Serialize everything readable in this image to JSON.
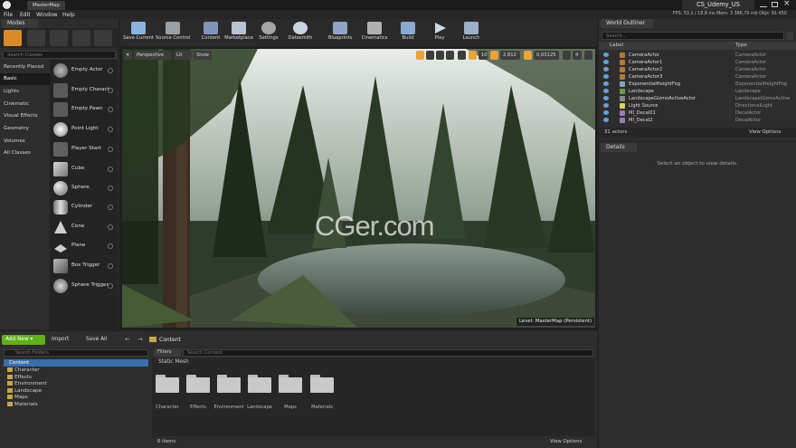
{
  "window": {
    "tab_title": "MasterMap",
    "project": "CS_Udemy_US",
    "menu": [
      "File",
      "Edit",
      "Window",
      "Help"
    ],
    "stats": "FPS: 53.2 / 18.8 ms   Mem: 3 386,79 mb   Objs: 91 450"
  },
  "modes": {
    "tab_label": "Modes",
    "search_placeholder": "Search Classes",
    "categories": [
      "Recently Placed",
      "Basic",
      "Lights",
      "Cinematic",
      "Visual Effects",
      "Geometry",
      "Volumes",
      "All Classes"
    ],
    "actors": [
      "Empty Actor",
      "Empty Charact",
      "Empty Pawn",
      "Point Light",
      "Player Start",
      "Cube",
      "Sphere",
      "Cylinder",
      "Cone",
      "Plane",
      "Box Trigger",
      "Sphere Trigger"
    ]
  },
  "toolbar": {
    "buttons": [
      "Save Current",
      "Source Control",
      "Content",
      "Marketplace",
      "Settings",
      "Datasmith",
      "Blueprints",
      "Cinematics",
      "Build",
      "Play",
      "Launch"
    ]
  },
  "viewport": {
    "perspective": "Perspective",
    "lit": "Lit",
    "show": "Show",
    "grid_value": "2,812",
    "rot_value": "0,03125",
    "cam_value": "4",
    "level_label": "Level:",
    "level_name": "MasterMap (Persistent)",
    "watermark": "CGer.com"
  },
  "outliner": {
    "tab_label": "World Outliner",
    "search_placeholder": "Search...",
    "col_label": "Label",
    "col_type": "Type",
    "rows": [
      {
        "label": "CameraActor",
        "type": "CameraActor"
      },
      {
        "label": "CameraActor1",
        "type": "CameraActor"
      },
      {
        "label": "CameraActor2",
        "type": "CameraActor"
      },
      {
        "label": "CameraActor3",
        "type": "CameraActor"
      },
      {
        "label": "ExponentialHeightFog",
        "type": "ExponentialHeightFog"
      },
      {
        "label": "Landscape",
        "type": "Landscape"
      },
      {
        "label": "LandscapeGizmoActiveActor",
        "type": "LandscapeGizmoActive"
      },
      {
        "label": "Light Source",
        "type": "DirectionalLight"
      },
      {
        "label": "MI_Decal01",
        "type": "DecalActor"
      },
      {
        "label": "MI_Decal2",
        "type": "DecalActor"
      }
    ],
    "count": "31 actors",
    "view_options": "View Options"
  },
  "details": {
    "tab_label": "Details",
    "empty_message": "Select an object to view details."
  },
  "content_browser": {
    "add_new": "Add New",
    "import": "Import",
    "save_all": "Save All",
    "path_label": "Content",
    "filters": "Filters",
    "search_assets_placeholder": "Search Content",
    "search_folders_placeholder": "Search Folders",
    "tree_root": "Content",
    "tree_items": [
      "Character",
      "Effects",
      "Environment",
      "Landscape",
      "Maps",
      "Materials"
    ],
    "section_title": "Static Mesh",
    "folders": [
      "Character",
      "Effects",
      "Environment",
      "Landscape",
      "Maps",
      "Materials"
    ],
    "count": "6 items",
    "view_options": "View Options"
  },
  "colors": {
    "accent_green": "#5fae1a",
    "selection_blue": "#2f5f9e",
    "accent_orange": "#e9a43a"
  }
}
